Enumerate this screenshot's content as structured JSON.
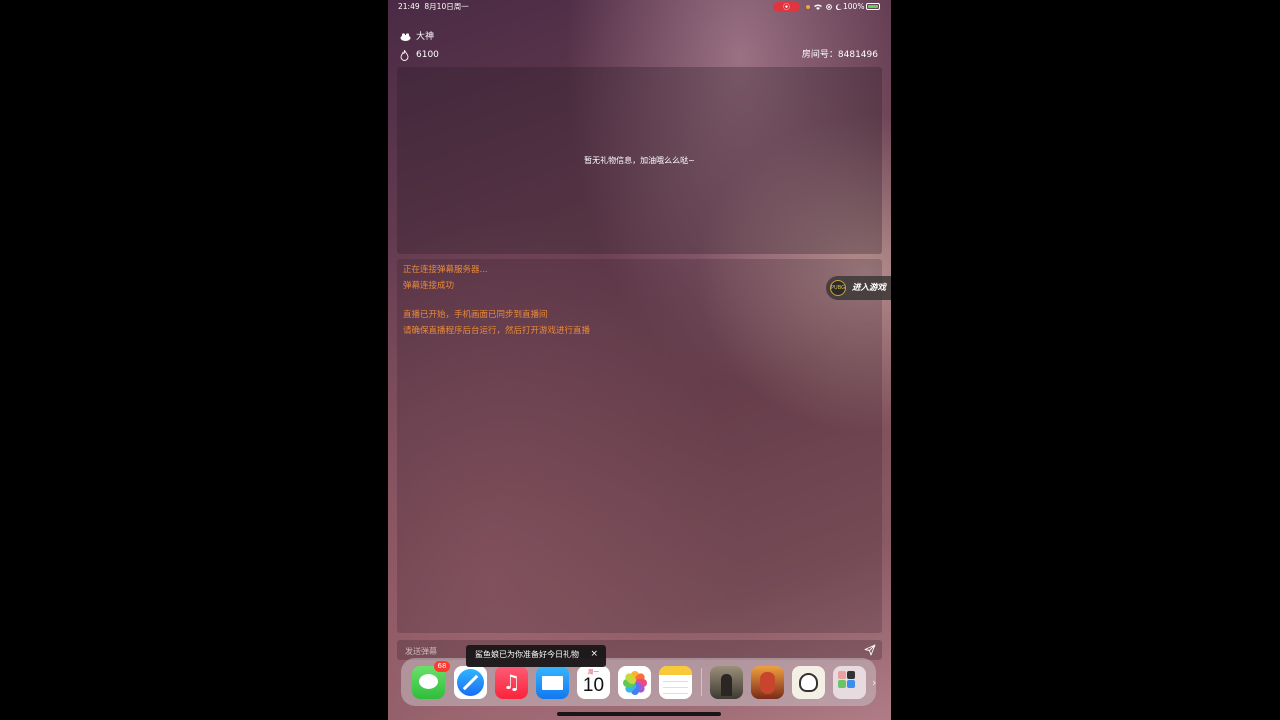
{
  "status_bar": {
    "time": "21:49",
    "date": "8月10日周一",
    "battery": "100%",
    "record_indicator": "⦿",
    "icons": [
      "wifi-icon",
      "location-icon",
      "moon-icon"
    ]
  },
  "header": {
    "user_name": "大神",
    "count": "6100",
    "room_id": "房间号：8481496"
  },
  "gift_panel": {
    "empty_text": "暂无礼物信息，加油哦么么哒~"
  },
  "chat": {
    "lines": [
      "正在连接弹幕服务器...",
      "弹幕连接成功",
      "直播已开始，手机画面已同步到直播间",
      "请确保直播程序后台运行，然后打开游戏进行直播"
    ]
  },
  "enter_game": {
    "label": "进入游戏",
    "logo_text": "PUBG"
  },
  "input": {
    "placeholder": "发送弹幕"
  },
  "toast": {
    "text": "鲨鱼娘已为你准备好今日礼物",
    "close": "×"
  },
  "dock": {
    "messages_badge": "68",
    "music_glyph": "♫",
    "calendar_day": "周一",
    "calendar_date": "10",
    "more": "›",
    "apps": [
      "messages-app",
      "safari-app",
      "music-app",
      "mail-app",
      "calendar-app",
      "photos-app",
      "notes-app",
      "pubg-mobile-app",
      "honor-of-kings-app",
      "huya-app",
      "app-folder"
    ]
  },
  "colors": {
    "chat_text": "#e88a3a",
    "record_red": "#e0353f",
    "badge_red": "#ff3b30"
  }
}
